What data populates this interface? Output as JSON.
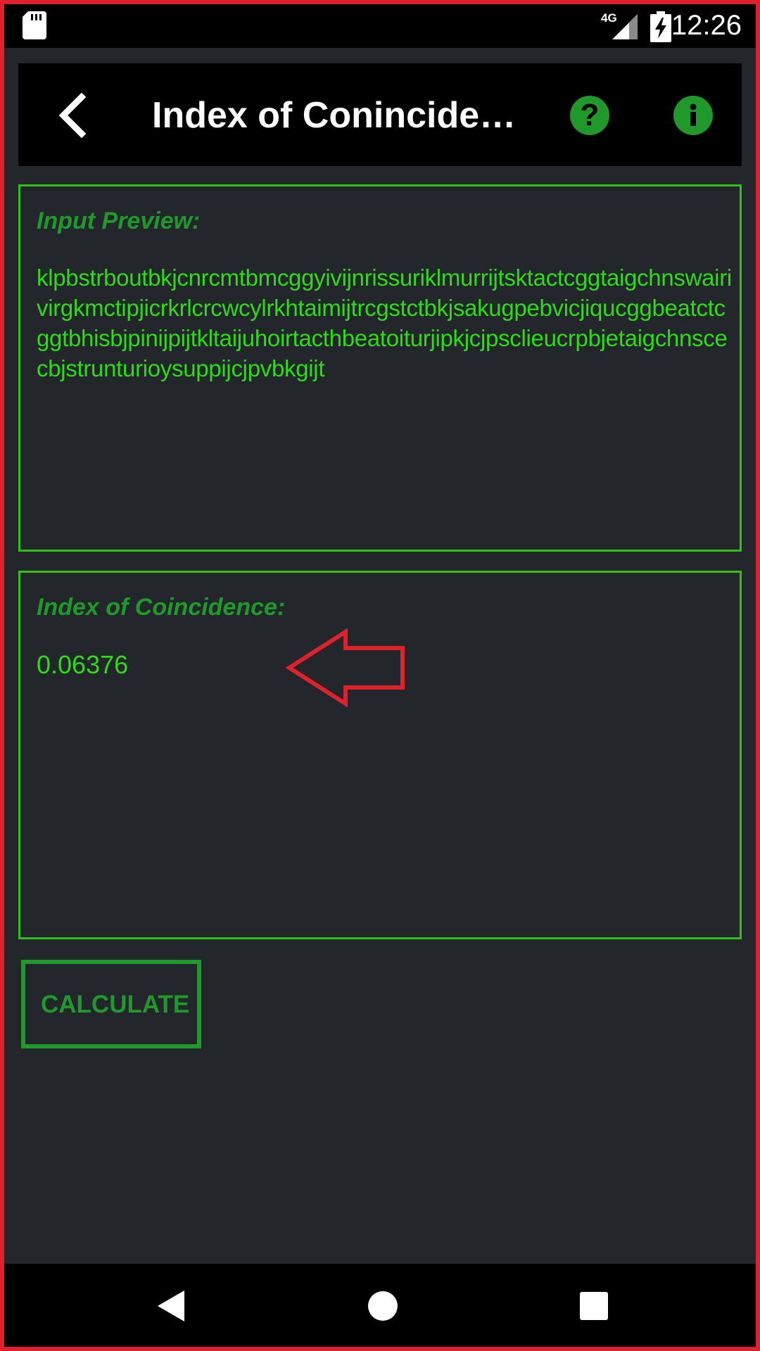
{
  "status_bar": {
    "network": "4G",
    "time": "12:26"
  },
  "app_bar": {
    "title": "Index of Coninciden…",
    "help_glyph": "?",
    "info_glyph": "i"
  },
  "input_panel": {
    "label": "Input Preview:",
    "text": "klpbstrboutbkjcnrcmtbmcggyivijnrissuriklmurrijtsktactcggtaigchnswairivirgkmctipjicrkrlcrcwcylrkhtaimijtrcgstctbkjsakugpebvicjiqucggbeatctcggtbhisbjpinijpijtkltaijuhoirtacthbeatoiturjipkjcjpsclieucrpbjetaigchnscecbjstrunturioysuppijcjpvbkgijt"
  },
  "result_panel": {
    "label": "Index of Coincidence:",
    "value": "0.06376"
  },
  "calculate_button": {
    "label": "CALCULATE"
  },
  "colors": {
    "accent_green": "#1f9a2a",
    "text_green": "#2ddc17",
    "border_green": "#32c018",
    "annotation_red": "#e0202a",
    "background": "#23262b"
  },
  "icons": {
    "status": [
      "sd-card-icon",
      "signal-icon",
      "battery-charging-icon"
    ],
    "app_bar": [
      "back-arrow-icon",
      "help-icon",
      "info-icon"
    ],
    "nav": [
      "nav-back-icon",
      "nav-home-icon",
      "nav-recents-icon"
    ],
    "annotation": "red-arrow-annotation"
  }
}
